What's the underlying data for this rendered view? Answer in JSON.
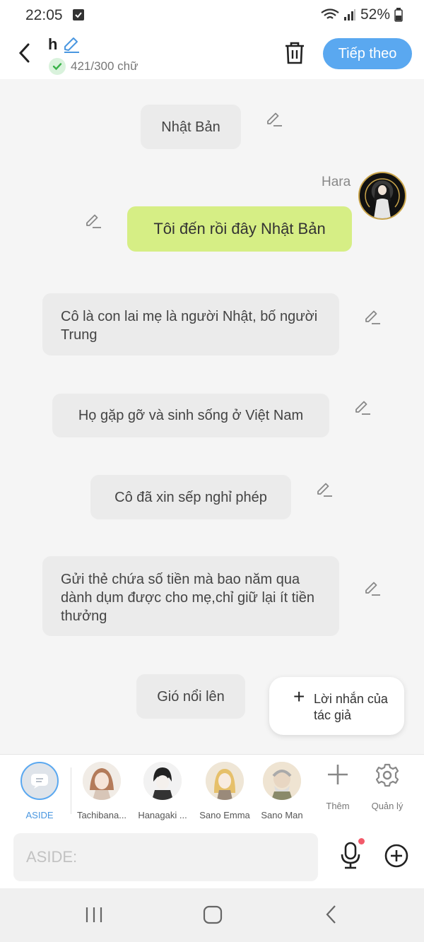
{
  "status_bar": {
    "time": "22:05",
    "battery": "52%"
  },
  "header": {
    "title": "h",
    "word_count": "421/300 chữ",
    "next_label": "Tiếp theo"
  },
  "messages": [
    {
      "type": "narration",
      "text": "Nhật Bản"
    },
    {
      "type": "user",
      "sender": "Hara",
      "text": "Tôi đến rồi đây Nhật Bản"
    },
    {
      "type": "narration",
      "text": "Cô là con lai mẹ là người Nhật, bố người Trung"
    },
    {
      "type": "narration",
      "text": "Họ gặp gỡ và sinh sống ở Việt Nam"
    },
    {
      "type": "narration",
      "text": "Cô đã xin sếp nghỉ phép"
    },
    {
      "type": "narration",
      "text": "Gửi thẻ chứa số tiền mà bao năm qua dành dụm được cho mẹ,chỉ giữ lại ít tiền thưởng"
    },
    {
      "type": "narration",
      "text": "Gió nổi lên"
    }
  ],
  "author_note": {
    "label": "Lời nhắn của tác giả"
  },
  "characters": [
    {
      "name": "ASIDE",
      "selected": true
    },
    {
      "name": "Tachibana..."
    },
    {
      "name": "Hanagaki ..."
    },
    {
      "name": "Sano Emma"
    },
    {
      "name": "Sano Man"
    }
  ],
  "tools": {
    "add": "Thêm",
    "manage": "Quản lý"
  },
  "input": {
    "placeholder": "ASIDE:"
  },
  "colors": {
    "accent": "#5aa8f0",
    "user_bubble": "#d6ee85",
    "narration_bubble": "#ebebeb"
  }
}
